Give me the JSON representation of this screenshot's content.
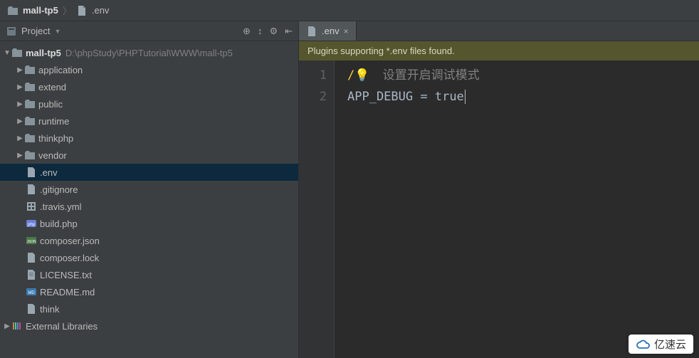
{
  "breadcrumb": {
    "project": "mall-tp5",
    "file": ".env"
  },
  "sidebar": {
    "title": "Project",
    "root": {
      "name": "mall-tp5",
      "path": "D:\\phpStudy\\PHPTutorial\\WWW\\mall-tp5"
    },
    "folders": [
      {
        "name": "application"
      },
      {
        "name": "extend"
      },
      {
        "name": "public"
      },
      {
        "name": "runtime"
      },
      {
        "name": "thinkphp"
      },
      {
        "name": "vendor"
      }
    ],
    "files": [
      {
        "name": ".env",
        "selected": true,
        "icon": "file"
      },
      {
        "name": ".gitignore",
        "icon": "file"
      },
      {
        "name": ".travis.yml",
        "icon": "grid"
      },
      {
        "name": "build.php",
        "icon": "php"
      },
      {
        "name": "composer.json",
        "icon": "json"
      },
      {
        "name": "composer.lock",
        "icon": "file"
      },
      {
        "name": "LICENSE.txt",
        "icon": "file"
      },
      {
        "name": "README.md",
        "icon": "md"
      },
      {
        "name": "think",
        "icon": "file"
      }
    ],
    "external": "External Libraries"
  },
  "editor": {
    "tab": ".env",
    "notice": "Plugins supporting *.env files found.",
    "lines": {
      "l1_comment": "设置开启调试模式",
      "l2_key": "APP_DEBUG",
      "l2_eq": " = ",
      "l2_val": "true"
    },
    "gutter": {
      "l1": "1",
      "l2": "2"
    }
  },
  "watermark": "亿速云"
}
